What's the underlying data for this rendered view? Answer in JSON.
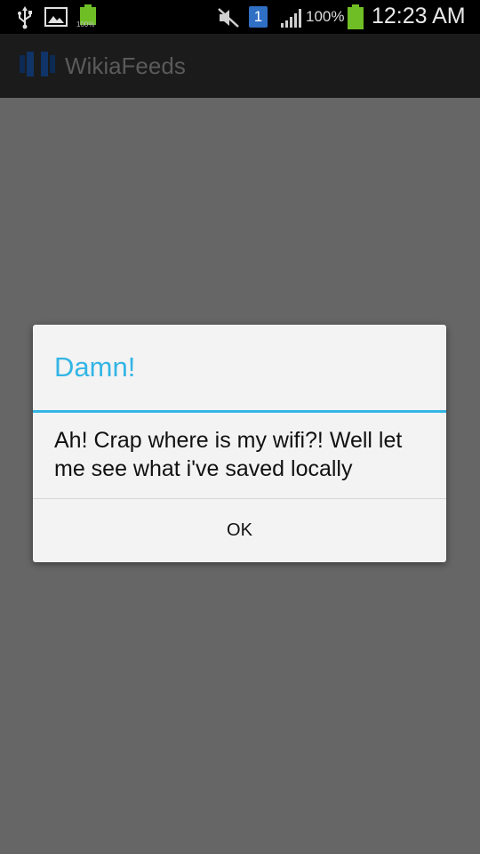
{
  "status_bar": {
    "left_icons": [
      "usb-icon",
      "image-icon",
      "battery-small-icon"
    ],
    "battery_small_label": "100%",
    "right_icons": [
      "mute-icon",
      "sim-1-icon",
      "signal-icon",
      "battery-icon"
    ],
    "sim_label": "1",
    "signal_percent": "100%",
    "time": "12:23 AM"
  },
  "action_bar": {
    "app_icon": "wikia-app-icon",
    "title": "WikiaFeeds"
  },
  "dialog": {
    "title": "Damn!",
    "message": "Ah! Crap where is my wifi?! Well let me see what i've saved locally",
    "ok_label": "OK",
    "accent_color": "#33b5e5"
  },
  "colors": {
    "dim_background": "#666666",
    "status_bar": "#000000",
    "action_bar": "#1b1b1b",
    "dialog_background": "#f3f3f3",
    "battery_green": "#6fbe26"
  }
}
